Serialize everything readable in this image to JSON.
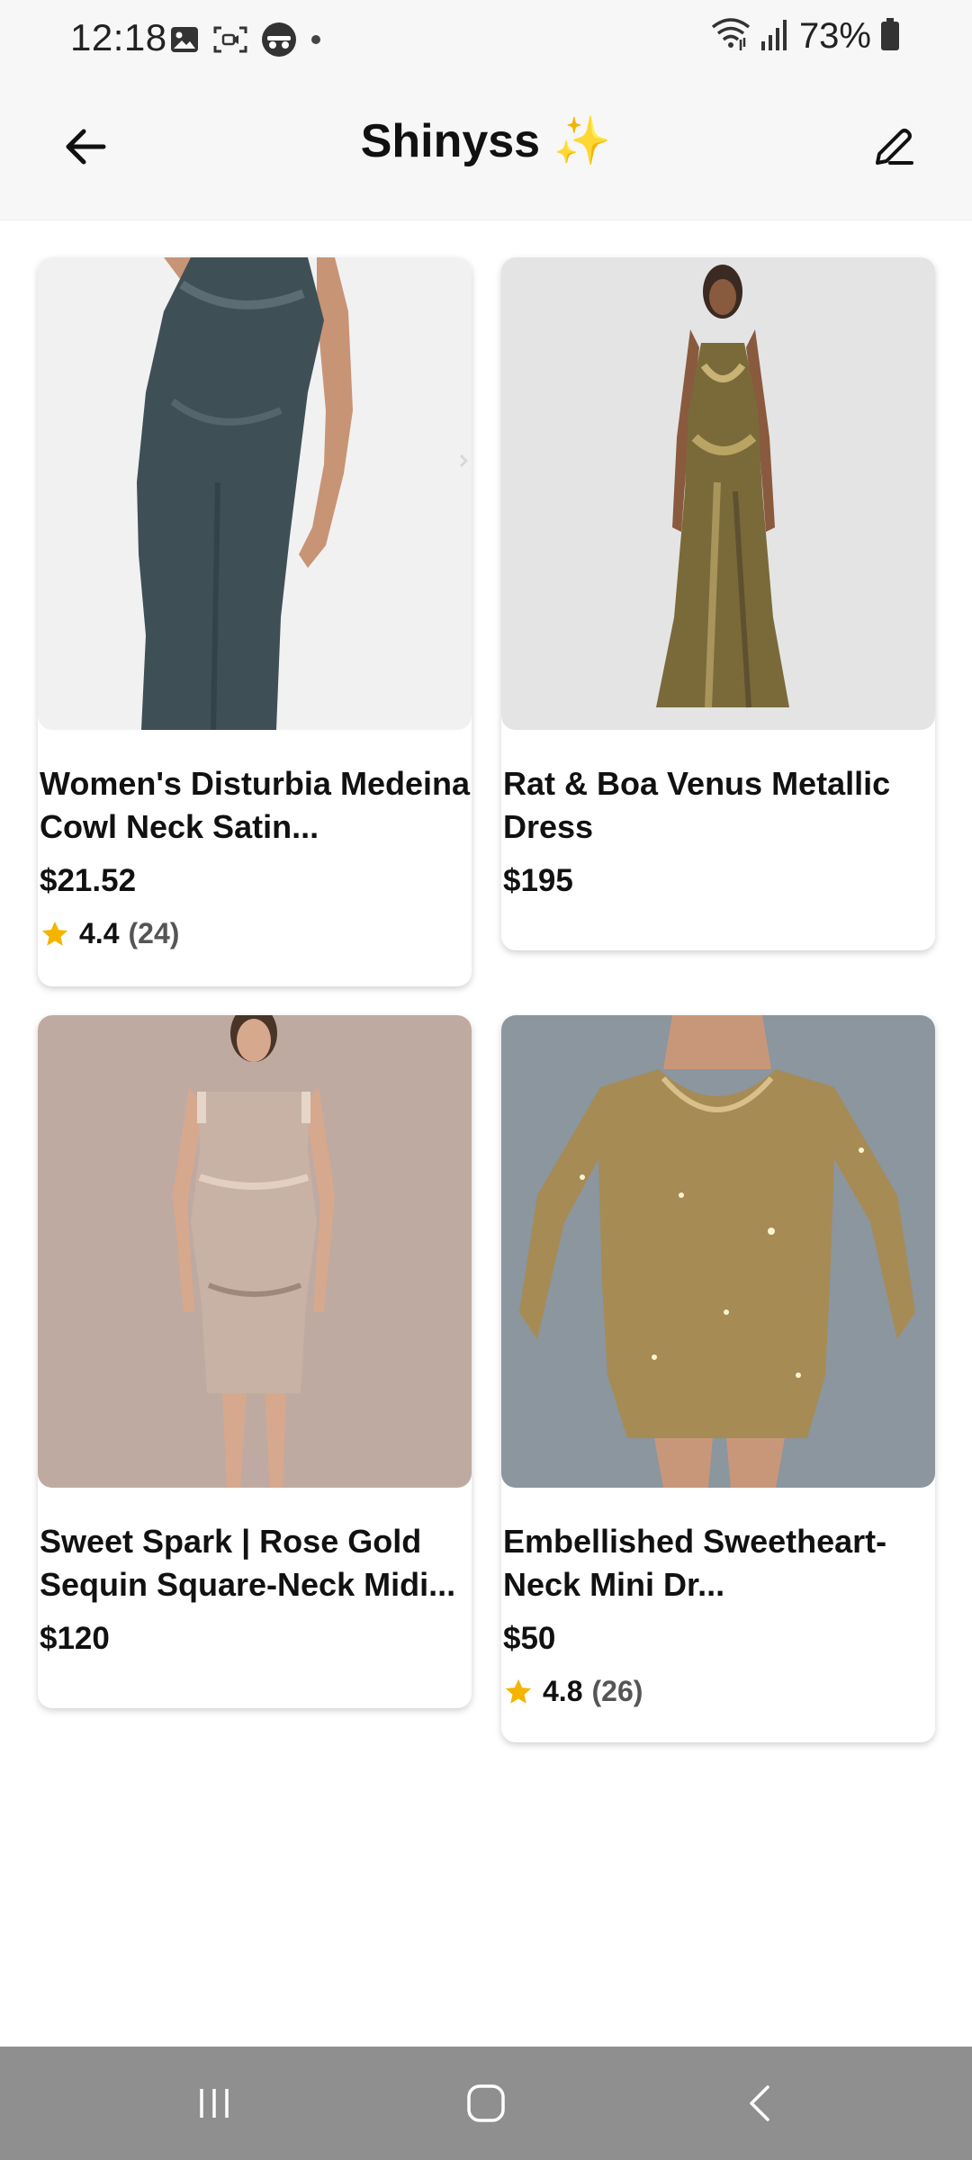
{
  "status_bar": {
    "time": "12:18",
    "left_icons": [
      "image-icon",
      "screen-record-icon",
      "incognito-icon",
      "dot-icon"
    ],
    "right_icons": [
      "wifi-icon",
      "signal-icon",
      "battery-icon"
    ],
    "battery": "73%"
  },
  "header": {
    "title": "Shinyss",
    "title_emoji": "✨",
    "back_icon": "arrow-left-icon",
    "edit_icon": "pencil-icon"
  },
  "products": [
    {
      "title": "Women's Disturbia Medeina Cowl Neck Satin...",
      "price": "$21.52",
      "rating": "4.4",
      "rating_count": "(24)",
      "image_colors": {
        "bg": "#f1f1f1",
        "dress": "#3f4f56"
      }
    },
    {
      "title": "Rat & Boa Venus Metallic Dress",
      "price": "$195",
      "image_colors": {
        "bg": "#e4e4e4",
        "dress": "#7a6a3a"
      }
    },
    {
      "title": "Sweet Spark | Rose Gold Sequin Square-Neck Midi...",
      "price": "$120",
      "image_colors": {
        "bg": "#bfaaa1",
        "dress": "#c8b2a5"
      }
    },
    {
      "title": "Embellished Sweetheart-Neck Mini Dr...",
      "price": "$50",
      "rating": "4.8",
      "rating_count": "(26)",
      "image_colors": {
        "bg": "#8b969e",
        "dress": "#a68b54"
      }
    }
  ],
  "nav_bar": {
    "buttons": [
      "recent-apps-icon",
      "home-icon",
      "back-icon"
    ]
  },
  "colors": {
    "star": "#f4b400",
    "header_bg": "#f7f7f7",
    "nav_bg": "#8f8f8f"
  }
}
